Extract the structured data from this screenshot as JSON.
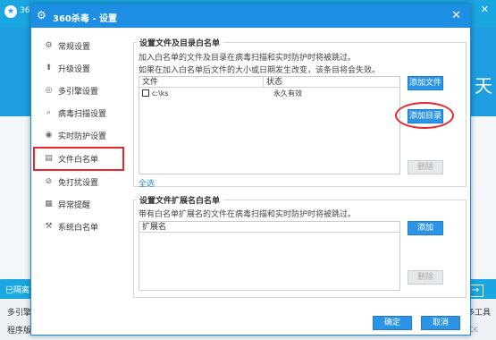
{
  "background": {
    "logo": "★",
    "title": "360",
    "minimize": "—",
    "close": "✕",
    "banner_char": "天",
    "status_text": "已隔离",
    "engine_text": "多引擎",
    "more_tools": "更多工具",
    "program_text": "程序版",
    "version_text": "00 CK",
    "arrow": "→"
  },
  "dialog": {
    "title": "360杀毒 - 设置",
    "close": "✕",
    "colors": {
      "accent": "#1c8ee3",
      "highlight": "#e8262b"
    },
    "nav": [
      {
        "label": "常规设置",
        "icon": "gear-icon",
        "glyph": "⚙"
      },
      {
        "label": "升级设置",
        "icon": "upgrade-icon",
        "glyph": "⬆"
      },
      {
        "label": "多引擎设置",
        "icon": "engine-icon",
        "glyph": "◎"
      },
      {
        "label": "病毒扫描设置",
        "icon": "search-icon",
        "glyph": "⌕"
      },
      {
        "label": "实时防护设置",
        "icon": "shield-icon",
        "glyph": "◉"
      },
      {
        "label": "文件白名单",
        "icon": "file-icon",
        "glyph": "▤",
        "active": true
      },
      {
        "label": "免打扰设置",
        "icon": "no-disturb-icon",
        "glyph": "⊘"
      },
      {
        "label": "异常提醒",
        "icon": "alert-icon",
        "glyph": "▦"
      },
      {
        "label": "系统白名单",
        "icon": "tools-icon",
        "glyph": "⚒"
      }
    ],
    "section1": {
      "title": "设置文件及目录白名单",
      "desc1": "加入白名单的文件及目录在病毒扫描和实时防护时将被跳过。",
      "desc2": "如果在加入白名单后文件的大小或日期发生改变，该条目将会失效。",
      "col_file": "文件",
      "col_status": "状态",
      "rows": [
        {
          "path": "c:\\ks",
          "status": "永久有效"
        }
      ],
      "add_file": "添加文件",
      "add_dir": "添加目录",
      "delete": "删除",
      "select_all": "全选"
    },
    "section2": {
      "title": "设置文件扩展名白名单",
      "desc": "带有白名单扩展名的文件在病毒扫描和实时防护时将被跳过。",
      "col_ext": "扩展名",
      "add": "添加",
      "delete": "删除"
    },
    "ok": "确定",
    "cancel": "取消"
  }
}
